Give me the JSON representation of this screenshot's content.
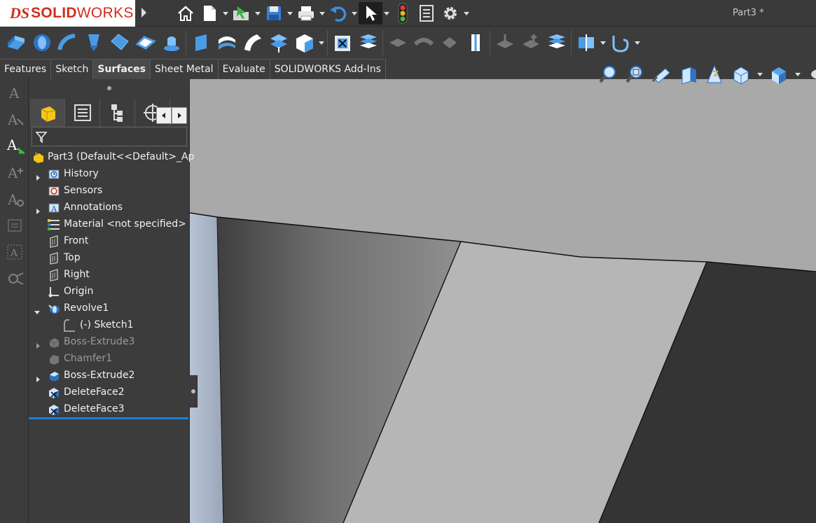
{
  "app": {
    "brand_prefix": "DS",
    "brand_bold": "SOLID",
    "brand_rest": "WORKS",
    "document_title": "Part3 *"
  },
  "menu_toolbar": {
    "icons": [
      "home-icon",
      "new-document-icon",
      "open-document-icon",
      "save-icon",
      "print-icon",
      "undo-icon",
      "select-arrow-icon",
      "rebuild-traffic-light-icon",
      "file-properties-icon",
      "options-gear-icon"
    ]
  },
  "command_tabs": [
    "Features",
    "Sketch",
    "Surfaces",
    "Sheet Metal",
    "Evaluate",
    "SOLIDWORKS Add-Ins"
  ],
  "active_tab": "Surfaces",
  "surfaces_toolbar": {
    "icons": [
      "extruded-surface-icon",
      "revolved-surface-icon",
      "swept-surface-icon",
      "lofted-surface-icon",
      "boundary-surface-icon",
      "filled-surface-icon",
      "freeform-icon",
      "planar-surface-icon",
      "offset-surface-icon",
      "ruled-surface-icon",
      "surface-flatten-icon",
      "delete-face-icon",
      "replace-face-icon",
      "extend-surface-icon",
      "trim-surface-icon",
      "untrim-surface-icon",
      "knit-surface-icon",
      "thicken-icon",
      "cut-with-surface-icon",
      "thickened-cut-icon",
      "mid-surface-icon",
      "split-line-icon",
      "curves-icon"
    ]
  },
  "heads_up_toolbar": {
    "icons": [
      "zoom-to-fit-icon",
      "zoom-to-area-icon",
      "previous-view-icon",
      "section-view-icon",
      "dynamic-annotation-view-icon",
      "view-orientation-icon",
      "display-style-icon",
      "hide-show-items-icon"
    ]
  },
  "task_pane_icons": [
    "smart-dimension-icon",
    "note-icon",
    "auto-dimension-icon",
    "annotation-grid-icon",
    "weld-symbol-icon",
    "datum-icon",
    "geometric-tolerance-icon",
    "surface-finish-icon"
  ],
  "feature_manager": {
    "tabs": [
      "feature-manager-tab",
      "property-manager-tab",
      "configuration-manager-tab",
      "dimxpert-manager-tab"
    ],
    "filter_icon": "filter-icon",
    "tree": [
      {
        "label": "Part3  (Default<<Default>_Ap",
        "icon": "part-icon",
        "level": 0,
        "expander": false,
        "dim": false
      },
      {
        "label": "History",
        "icon": "history-icon",
        "level": 1,
        "expander": true,
        "dim": false
      },
      {
        "label": "Sensors",
        "icon": "sensors-icon",
        "level": 1,
        "expander": false,
        "dim": false
      },
      {
        "label": "Annotations",
        "icon": "annotations-icon",
        "level": 1,
        "expander": true,
        "dim": false
      },
      {
        "label": "Material <not specified>",
        "icon": "material-icon",
        "level": 1,
        "expander": false,
        "dim": false
      },
      {
        "label": "Front",
        "icon": "plane-icon",
        "level": 1,
        "expander": false,
        "dim": false
      },
      {
        "label": "Top",
        "icon": "plane-icon",
        "level": 1,
        "expander": false,
        "dim": false
      },
      {
        "label": "Right",
        "icon": "plane-icon",
        "level": 1,
        "expander": false,
        "dim": false
      },
      {
        "label": "Origin",
        "icon": "origin-icon",
        "level": 1,
        "expander": false,
        "dim": false
      },
      {
        "label": "Revolve1",
        "icon": "revolve-icon",
        "level": 1,
        "expander": true,
        "expanded": true,
        "dim": false
      },
      {
        "label": "(-) Sketch1",
        "icon": "sketch-icon",
        "level": 2,
        "expander": false,
        "dim": false
      },
      {
        "label": "Boss-Extrude3",
        "icon": "extrude-icon",
        "level": 1,
        "expander": true,
        "dim": true
      },
      {
        "label": "Chamfer1",
        "icon": "chamfer-icon",
        "level": 1,
        "expander": false,
        "dim": true
      },
      {
        "label": "Boss-Extrude2",
        "icon": "extrude-icon",
        "level": 1,
        "expander": true,
        "dim": false
      },
      {
        "label": "DeleteFace2",
        "icon": "delete-face-icon",
        "level": 1,
        "expander": false,
        "dim": false
      },
      {
        "label": "DeleteFace3",
        "icon": "delete-face-icon",
        "level": 1,
        "expander": false,
        "dim": false
      }
    ]
  },
  "colors": {
    "brand_red": "#d52b1e",
    "rollback_bar": "#1e7fd8",
    "viewport_bg": "#a9a9a9"
  }
}
